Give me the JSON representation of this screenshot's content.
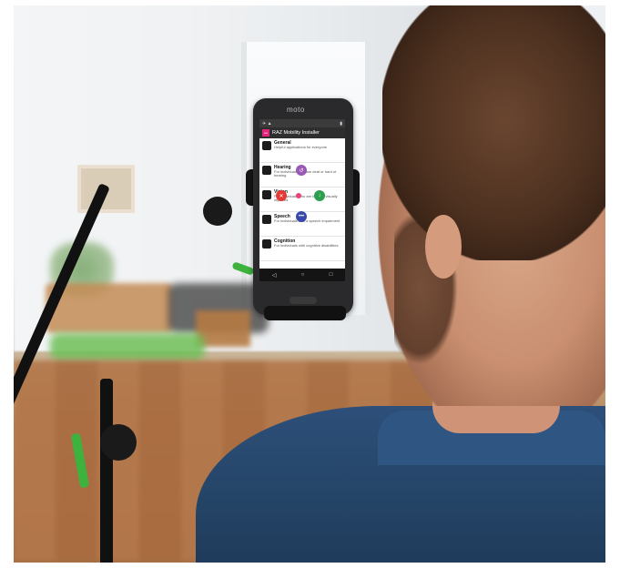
{
  "phone": {
    "brand": "moto",
    "app_title": "RAZ Mobility Installer",
    "status_time": "",
    "items": [
      {
        "title": "General",
        "desc": "Helpful applications for everyone"
      },
      {
        "title": "Hearing",
        "desc": "For individuals who are deaf or hard of hearing"
      },
      {
        "title": "Vision",
        "desc": "For individuals who are blind or visually impaired"
      },
      {
        "title": "Speech",
        "desc": "For individuals with a speech impairment"
      },
      {
        "title": "Cognition",
        "desc": "For individuals with cognitive disabilities"
      }
    ],
    "nav": {
      "back": "◁",
      "home": "○",
      "recent": "□"
    }
  },
  "colors": {
    "accent": "#e3247b",
    "shirt": "#2d4f79",
    "stand_clip": "#3db23d"
  }
}
